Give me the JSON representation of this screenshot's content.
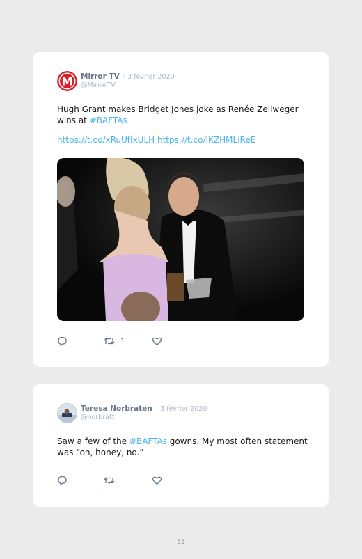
{
  "tweets": [
    {
      "author": "Mirror TV",
      "sep_date": "· 3 février 2020",
      "handle": "@MirrorTV",
      "avatar_letter": "M",
      "text_before": "Hugh Grant makes Bridget Jones joke as Renée Zellweger wins at ",
      "hashtag": "#BAFTAs",
      "link1": "https://t.co/xRuUfIxULH",
      "link2": "https://t.co/IKZHMLiReE",
      "retweets": "1"
    },
    {
      "author": "Teresa Norbraten",
      "sep_date": "· 3 février 2020",
      "handle": "@norbratt",
      "text_before": "Saw a few of the ",
      "hashtag": "#BAFTAs",
      "text_after": " gowns. My most often statement was “oh, honey, no.”"
    }
  ],
  "page_number": "55",
  "colors": {
    "link": "#4ab3f4",
    "icon": "#657786",
    "mirror_red": "#d8202a"
  }
}
